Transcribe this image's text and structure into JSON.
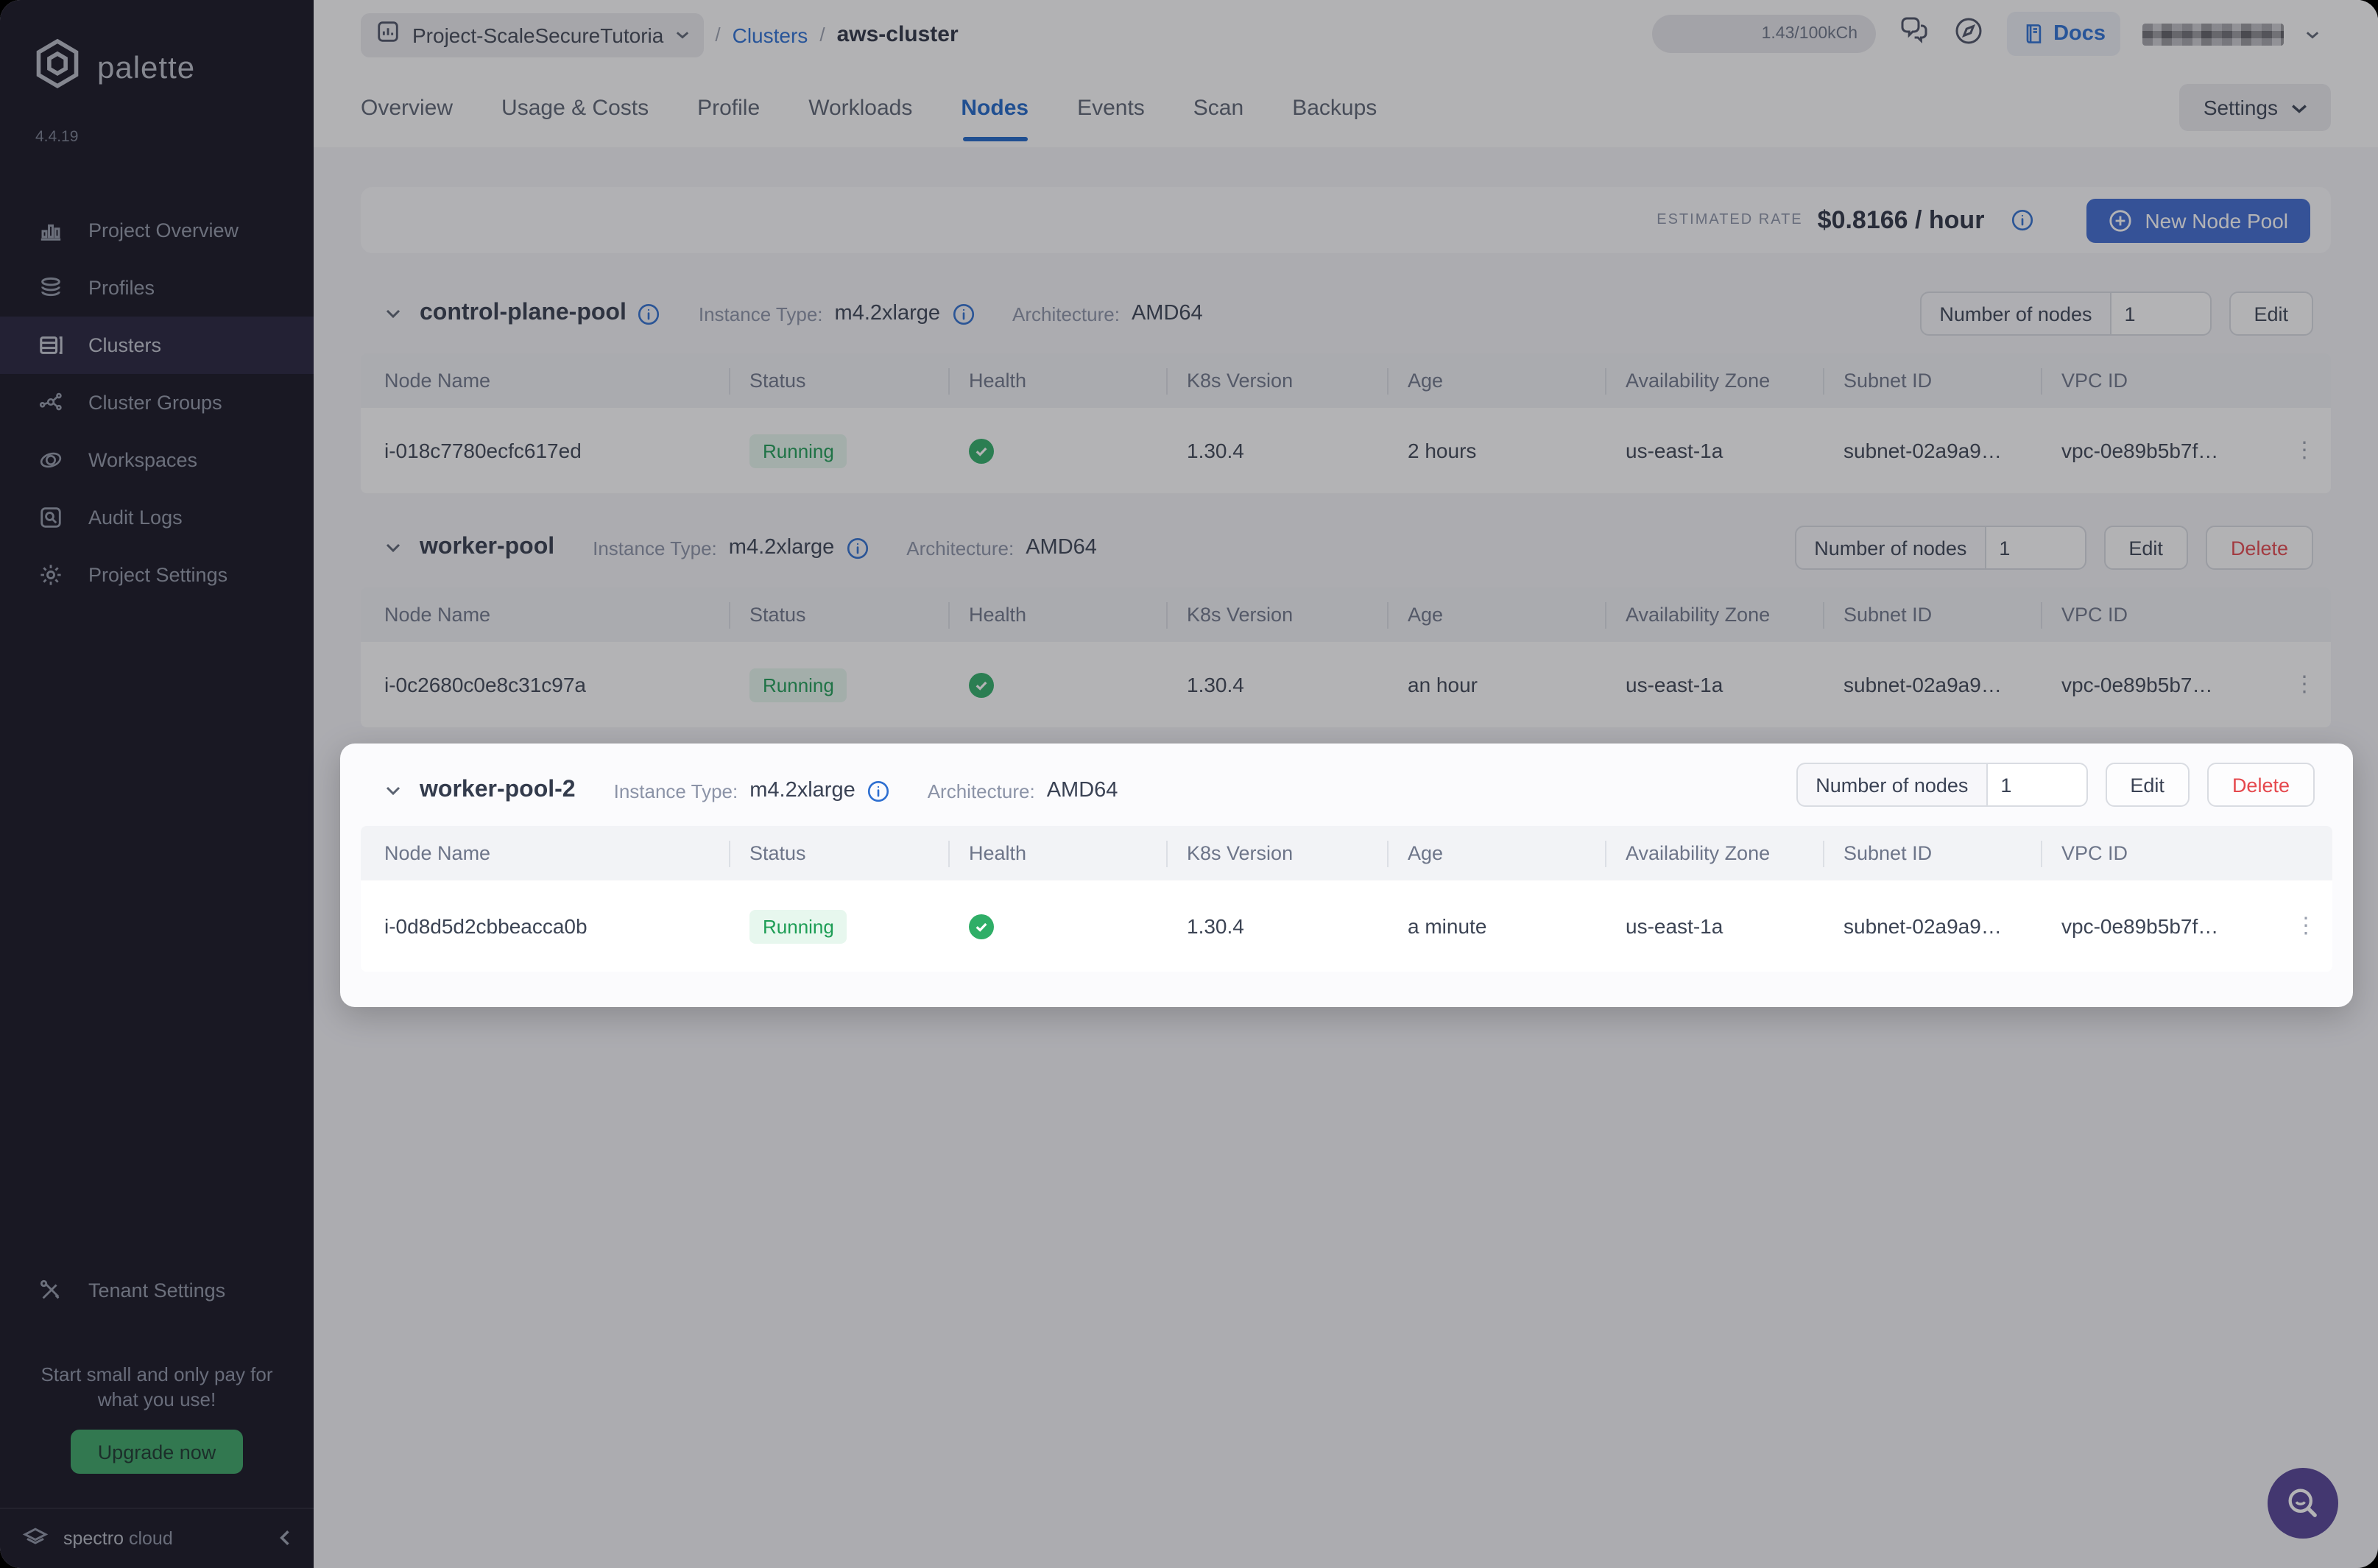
{
  "app": {
    "brand": "palette",
    "version": "4.4.19",
    "footer_brand": "spectro",
    "footer_brand_2": "cloud"
  },
  "colors": {
    "accent_blue": "#3e6ad2",
    "link_blue": "#2a6fd4",
    "active_tab_blue": "#1e66c8",
    "success_green": "#2fae67",
    "danger_red": "#e5484d",
    "upgrade_green": "#3aa565",
    "fab_purple": "#544195",
    "sidebar_bg": "#131120"
  },
  "sidebar": {
    "items": [
      {
        "label": "Project Overview"
      },
      {
        "label": "Profiles"
      },
      {
        "label": "Clusters"
      },
      {
        "label": "Cluster Groups"
      },
      {
        "label": "Workspaces"
      },
      {
        "label": "Audit Logs"
      },
      {
        "label": "Project Settings"
      }
    ],
    "active": "Clusters",
    "tenant_settings": "Tenant Settings",
    "promo_text": "Start small and only pay for what you use!",
    "upgrade_button": "Upgrade now"
  },
  "header": {
    "project": "Project-ScaleSecureTutoria",
    "sep": "/",
    "clusters_link": "Clusters",
    "cluster_name": "aws-cluster",
    "credits": "1.43/100kCh",
    "docs_label": "Docs"
  },
  "tabs": {
    "items": [
      "Overview",
      "Usage & Costs",
      "Profile",
      "Workloads",
      "Nodes",
      "Events",
      "Scan",
      "Backups"
    ],
    "active": "Nodes",
    "settings_button": "Settings"
  },
  "rate_bar": {
    "label": "ESTIMATED RATE",
    "value": "$0.8166 / hour",
    "new_pool_button": "New Node Pool"
  },
  "table": {
    "columns": [
      "Node Name",
      "Status",
      "Health",
      "K8s Version",
      "Age",
      "Availability Zone",
      "Subnet ID",
      "VPC ID"
    ]
  },
  "pools": [
    {
      "name": "control-plane-pool",
      "instance_type_label": "Instance Type:",
      "instance_type": "m4.2xlarge",
      "architecture_label": "Architecture:",
      "architecture": "AMD64",
      "nodes_label": "Number of nodes",
      "nodes_value": "1",
      "edit": "Edit",
      "row": {
        "name": "i-018c7780ecfc617ed",
        "status": "Running",
        "k8s": "1.30.4",
        "age": "2 hours",
        "az": "us-east-1a",
        "subnet": "subnet-02a9a9…",
        "vpc": "vpc-0e89b5b7f…"
      }
    },
    {
      "name": "worker-pool",
      "instance_type_label": "Instance Type:",
      "instance_type": "m4.2xlarge",
      "architecture_label": "Architecture:",
      "architecture": "AMD64",
      "nodes_label": "Number of nodes",
      "nodes_value": "1",
      "edit": "Edit",
      "delete": "Delete",
      "row": {
        "name": "i-0c2680c0e8c31c97a",
        "status": "Running",
        "k8s": "1.30.4",
        "age": "an hour",
        "az": "us-east-1a",
        "subnet": "subnet-02a9a9…",
        "vpc": "vpc-0e89b5b7…"
      }
    },
    {
      "name": "worker-pool-2",
      "instance_type_label": "Instance Type:",
      "instance_type": "m4.2xlarge",
      "architecture_label": "Architecture:",
      "architecture": "AMD64",
      "nodes_label": "Number of nodes",
      "nodes_value": "1",
      "edit": "Edit",
      "delete": "Delete",
      "highlighted": true,
      "row": {
        "name": "i-0d8d5d2cbbeacca0b",
        "status": "Running",
        "k8s": "1.30.4",
        "age": "a minute",
        "az": "us-east-1a",
        "subnet": "subnet-02a9a9…",
        "vpc": "vpc-0e89b5b7f…"
      }
    }
  ]
}
